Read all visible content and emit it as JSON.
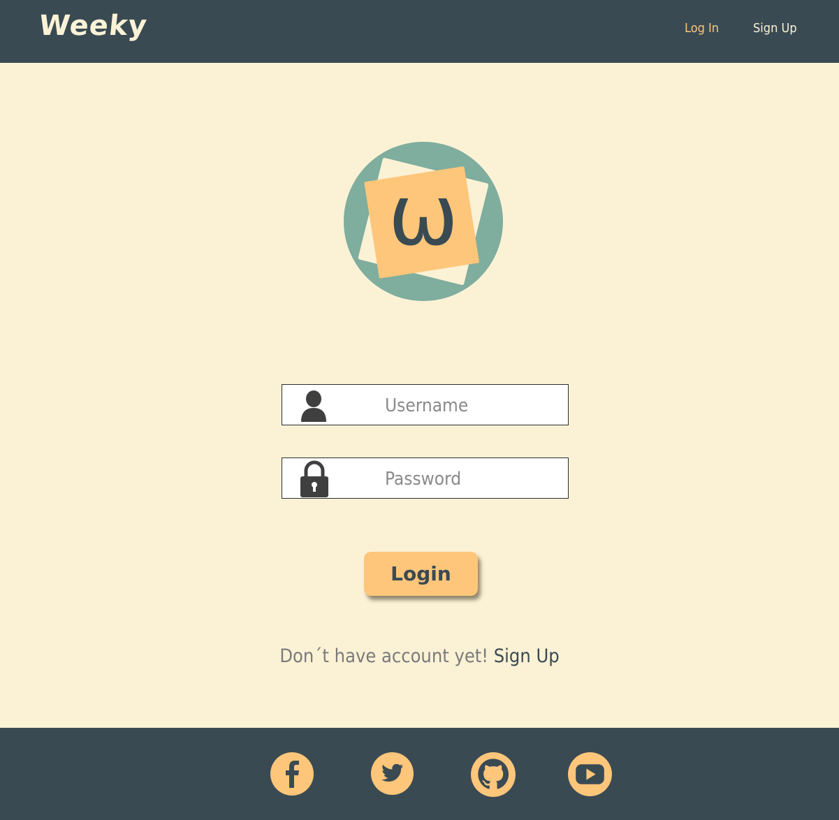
{
  "header": {
    "brand": "Weeky",
    "nav": {
      "login_label": "Log In",
      "signup_label": "Sign Up"
    }
  },
  "form": {
    "username_placeholder": "Username",
    "password_placeholder": "Password",
    "login_button": "Login"
  },
  "signup_prompt": {
    "text": "Don´t have account yet!",
    "link": "Sign Up"
  },
  "logo": {
    "letter": "ω"
  },
  "footer": {
    "social": [
      {
        "name": "facebook-icon"
      },
      {
        "name": "twitter-icon"
      },
      {
        "name": "github-icon"
      },
      {
        "name": "youtube-icon"
      }
    ]
  },
  "colors": {
    "header_bg": "#3A4A52",
    "page_bg": "#FBF2D6",
    "accent": "#FDC67A",
    "teal": "#7FAD9E",
    "active_nav": "#FDC67A",
    "inactive_nav": "#FBF2D6"
  }
}
